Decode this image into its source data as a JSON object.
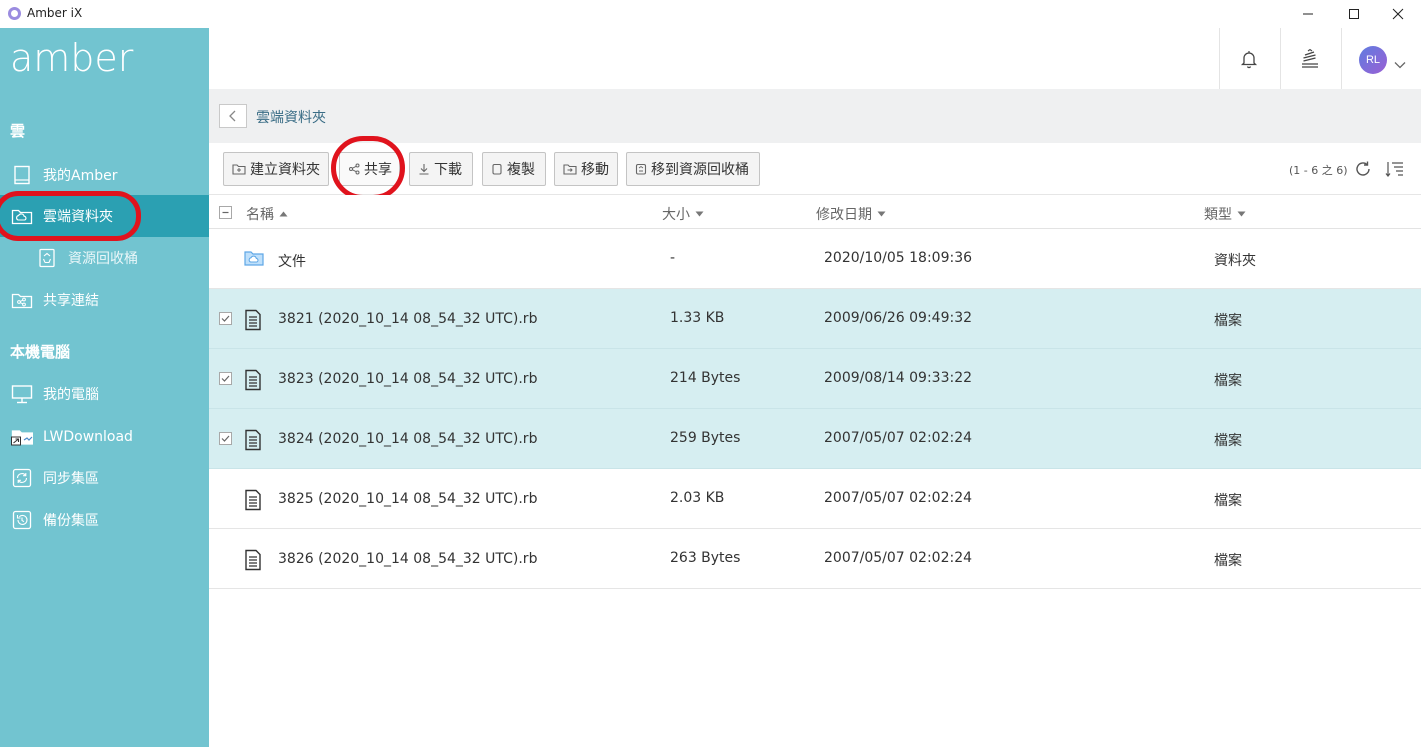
{
  "window": {
    "title": "Amber iX"
  },
  "sidebar": {
    "logo": "amber",
    "section_cloud": "雲",
    "section_local": "本機電腦",
    "items": [
      {
        "label": "我的Amber",
        "icon": "document-icon"
      },
      {
        "label": "雲端資料夾",
        "icon": "cloud-folder-icon"
      },
      {
        "label": "資源回收桶",
        "icon": "recycle-icon"
      },
      {
        "label": "共享連結",
        "icon": "share-folder-icon"
      },
      {
        "label": "我的電腦",
        "icon": "monitor-icon"
      },
      {
        "label": "LWDownload",
        "icon": "shortcut-folder-icon"
      },
      {
        "label": "同步集區",
        "icon": "sync-icon"
      },
      {
        "label": "備份集區",
        "icon": "backup-icon"
      }
    ]
  },
  "header": {
    "avatar_initials": "RL",
    "notification_icon": "bell-icon",
    "tasks_icon": "stack-icon"
  },
  "breadcrumb": {
    "current": "雲端資料夾"
  },
  "toolbar": {
    "new_folder": "建立資料夾",
    "share": "共享",
    "download": "下載",
    "copy": "複製",
    "move": "移動",
    "move_to_trash": "移到資源回收桶",
    "count": "(1 - 6 之 6)"
  },
  "table": {
    "headers": {
      "name": "名稱",
      "size": "大小",
      "modified": "修改日期",
      "type": "類型"
    },
    "rows": [
      {
        "name": "文件",
        "size": "-",
        "modified": "2020/10/05 18:09:36",
        "type": "資料夾",
        "kind": "folder",
        "selected": false
      },
      {
        "name": "3821 (2020_10_14 08_54_32 UTC).rb",
        "size": "1.33 KB",
        "modified": "2009/06/26 09:49:32",
        "type": "檔案",
        "kind": "file",
        "selected": true
      },
      {
        "name": "3823 (2020_10_14 08_54_32 UTC).rb",
        "size": "214 Bytes",
        "modified": "2009/08/14 09:33:22",
        "type": "檔案",
        "kind": "file",
        "selected": true
      },
      {
        "name": "3824 (2020_10_14 08_54_32 UTC).rb",
        "size": "259 Bytes",
        "modified": "2007/05/07 02:02:24",
        "type": "檔案",
        "kind": "file",
        "selected": true
      },
      {
        "name": "3825 (2020_10_14 08_54_32 UTC).rb",
        "size": "2.03 KB",
        "modified": "2007/05/07 02:02:24",
        "type": "檔案",
        "kind": "file",
        "selected": false
      },
      {
        "name": "3826 (2020_10_14 08_54_32 UTC).rb",
        "size": "263 Bytes",
        "modified": "2007/05/07 02:02:24",
        "type": "檔案",
        "kind": "file",
        "selected": false
      }
    ]
  },
  "colors": {
    "sidebar": "#72c4d0",
    "sidebar_active": "#2ba0b2",
    "selected_row": "#d6eef1",
    "highlight_ring": "#e0131d"
  }
}
